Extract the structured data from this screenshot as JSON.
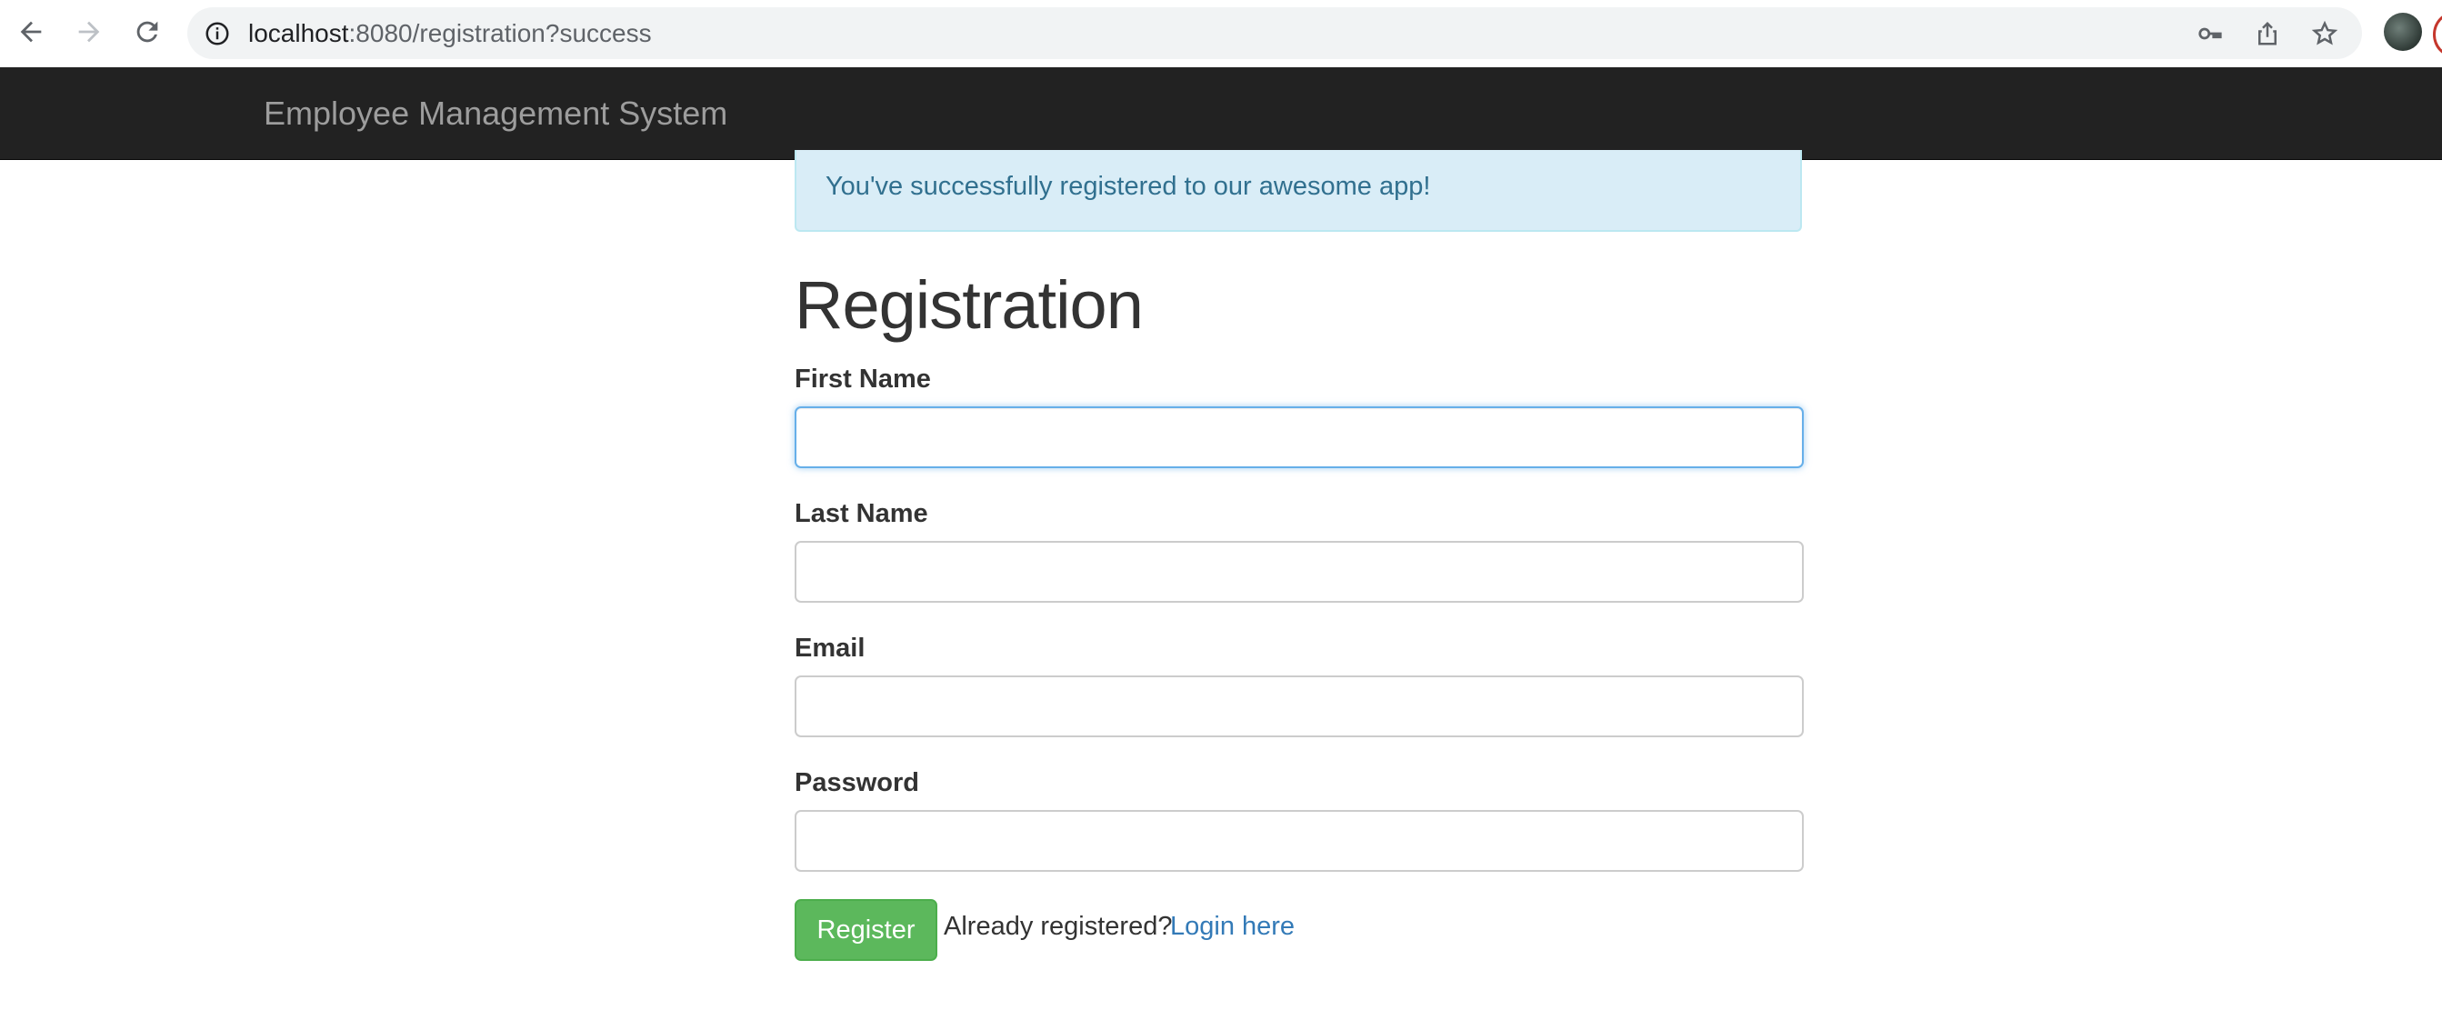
{
  "browser": {
    "url_host": "localhost",
    "url_rest": ":8080/registration?success",
    "icons": [
      "back-arrow-icon",
      "forward-arrow-icon",
      "reload-icon",
      "site-info-icon",
      "key-icon",
      "share-icon",
      "bookmark-star-icon",
      "profile-avatar"
    ]
  },
  "navbar": {
    "brand": "Employee Management System"
  },
  "alert": {
    "message": "You've successfully registered to our awesome app!"
  },
  "form": {
    "heading": "Registration",
    "fields": [
      {
        "label": "First Name",
        "value": ""
      },
      {
        "label": "Last Name",
        "value": ""
      },
      {
        "label": "Email",
        "value": ""
      },
      {
        "label": "Password",
        "value": ""
      }
    ],
    "submit_label": "Register",
    "already_text": "Already registered?",
    "login_link": "Login here"
  },
  "colors": {
    "navbar_bg": "#222222",
    "alert_bg": "#d9edf7",
    "alert_text": "#31708f",
    "button_bg": "#5cb85c",
    "link": "#337ab7"
  }
}
